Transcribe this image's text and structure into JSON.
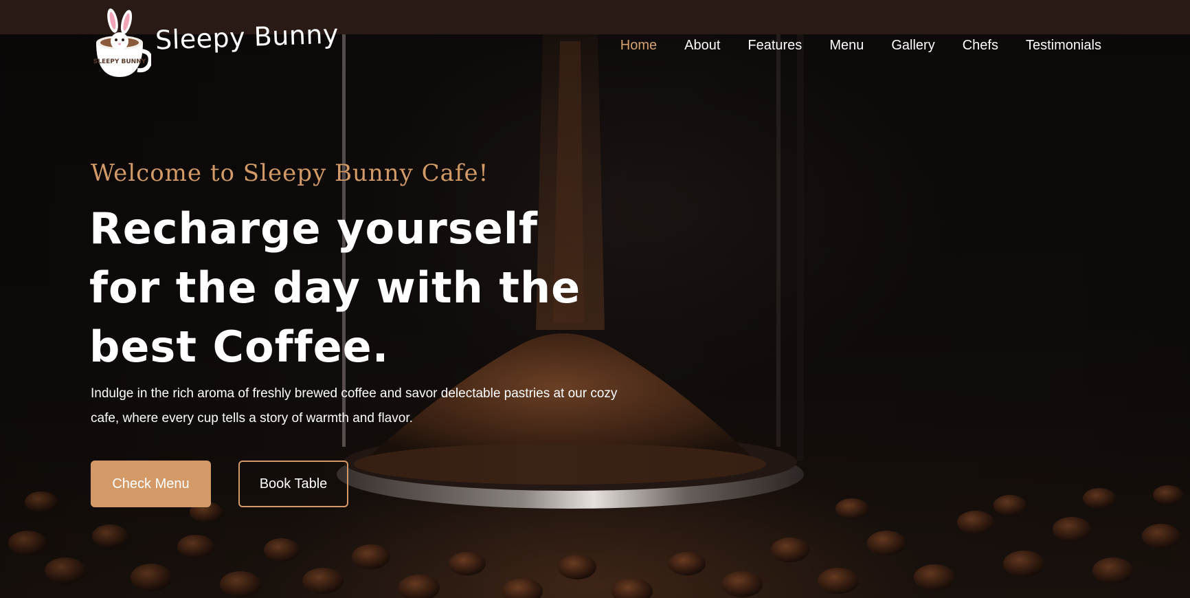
{
  "brand": {
    "name": "Sleepy Bunny",
    "logo_text": "SLEEPY BUNNY"
  },
  "nav": {
    "items": [
      {
        "label": "Home",
        "active": true
      },
      {
        "label": "About"
      },
      {
        "label": "Features"
      },
      {
        "label": "Menu"
      },
      {
        "label": "Gallery"
      },
      {
        "label": "Chefs"
      },
      {
        "label": "Testimonials"
      }
    ]
  },
  "hero": {
    "welcome": "Welcome to Sleepy Bunny Cafe!",
    "headline": "Recharge yourself for the day with the best Coffee.",
    "description": "Indulge in the rich aroma of freshly brewed coffee and savor delectable pastries at our cozy cafe, where every cup tells a story of warmth and flavor.",
    "check_menu": "Check Menu",
    "book_table": "Book Table"
  },
  "colors": {
    "accent": "#d39a68",
    "nav_active": "#d6a26f",
    "top_strip": "#2a1a16",
    "background": "#0c0908"
  },
  "icons": [
    "bunny-coffee-cup-logo"
  ]
}
